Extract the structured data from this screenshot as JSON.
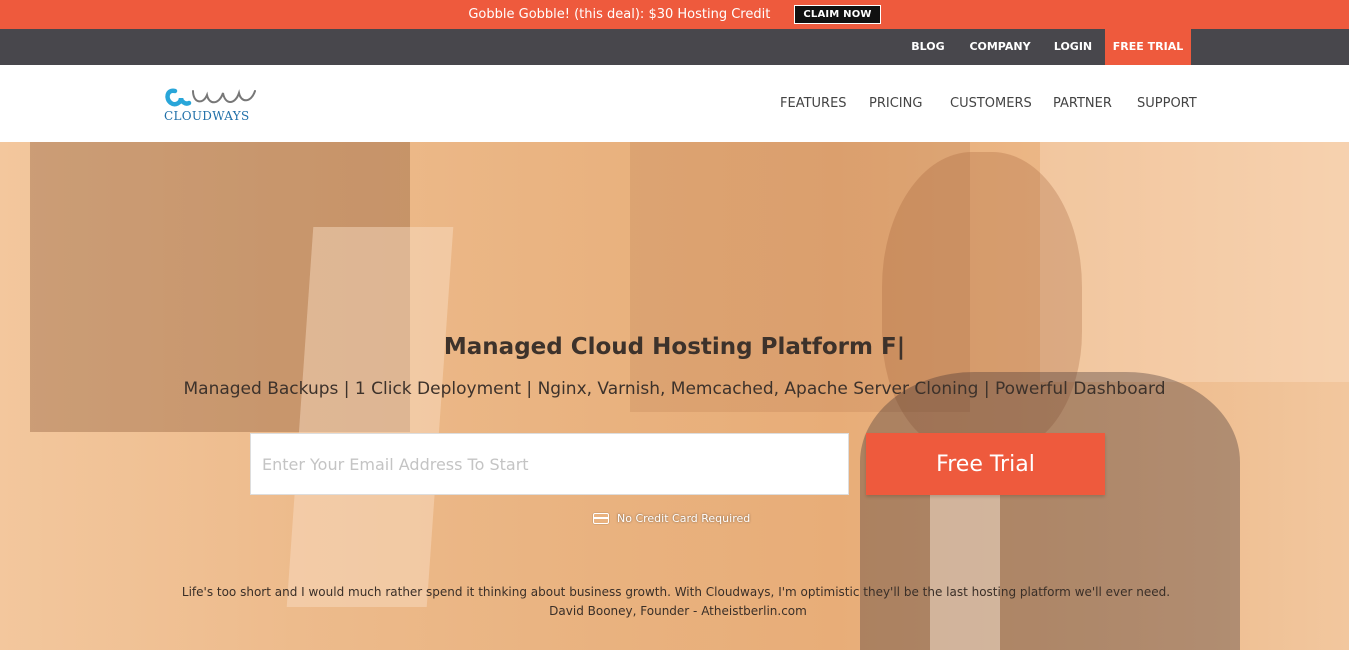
{
  "promo": {
    "text": "Gobble Gobble! (this deal): $30 Hosting Credit",
    "cta": "CLAIM NOW"
  },
  "utility_nav": {
    "blog": "BLOG",
    "company": "COMPANY",
    "login": "LOGIN",
    "free_trial": "FREE TRIAL"
  },
  "brand": {
    "logo_text": "CLOUDWAYS",
    "icon": "cloudways-wave-logo"
  },
  "main_nav": {
    "features": "FEATURES",
    "pricing": "PRICING",
    "customers": "CUSTOMERS",
    "partner": "PARTNER",
    "support": "SUPPORT"
  },
  "hero": {
    "title": "Managed Cloud Hosting Platform F|",
    "subtitle": "Managed Backups | 1 Click Deployment | Nginx, Varnish, Memcached, Apache Server Cloning | Powerful Dashboard",
    "email_placeholder": "Enter Your Email Address To Start",
    "email_value": "",
    "cta": "Free Trial",
    "no_cc": "No Credit Card Required",
    "no_cc_icon": "credit-card-icon",
    "quote": "Life's too short and I would much rather spend it thinking about business growth. With Cloudways, I'm optimistic they'll be the last hosting platform we'll ever need.",
    "author": "David Booney, Founder - Atheistberlin.com"
  },
  "colors": {
    "accent": "#ee5a3d",
    "utility_bar": "#48474c",
    "brand_blue": "#1f6fa8",
    "logo_cyan": "#29a6d9"
  }
}
